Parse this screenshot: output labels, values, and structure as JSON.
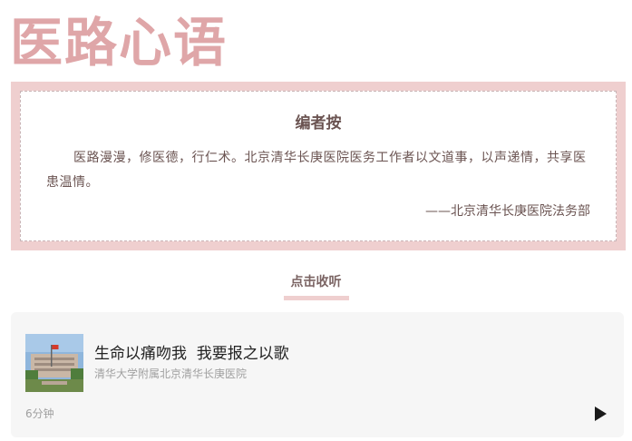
{
  "colors": {
    "accent_pink": "#dfa6a8",
    "frame_pink": "#efcfcf",
    "text_brown": "#6b5452",
    "card_bg": "#f6f6f6"
  },
  "header": {
    "title": "医路心语"
  },
  "editor_note": {
    "heading": "编者按",
    "body": "医路漫漫，修医德，行仁术。北京清华长庚医院医务工作者以文道事，以声递情，共享医患温情。",
    "signature": "——北京清华长庚医院法务部"
  },
  "listen": {
    "label": "点击收听"
  },
  "audio": {
    "thumbnail_icon": "hospital-building-photo",
    "title": "生命以痛吻我  我要报之以歌",
    "source": "清华大学附属北京清华长庚医院",
    "duration": "6分钟",
    "play_icon": "play-icon"
  }
}
